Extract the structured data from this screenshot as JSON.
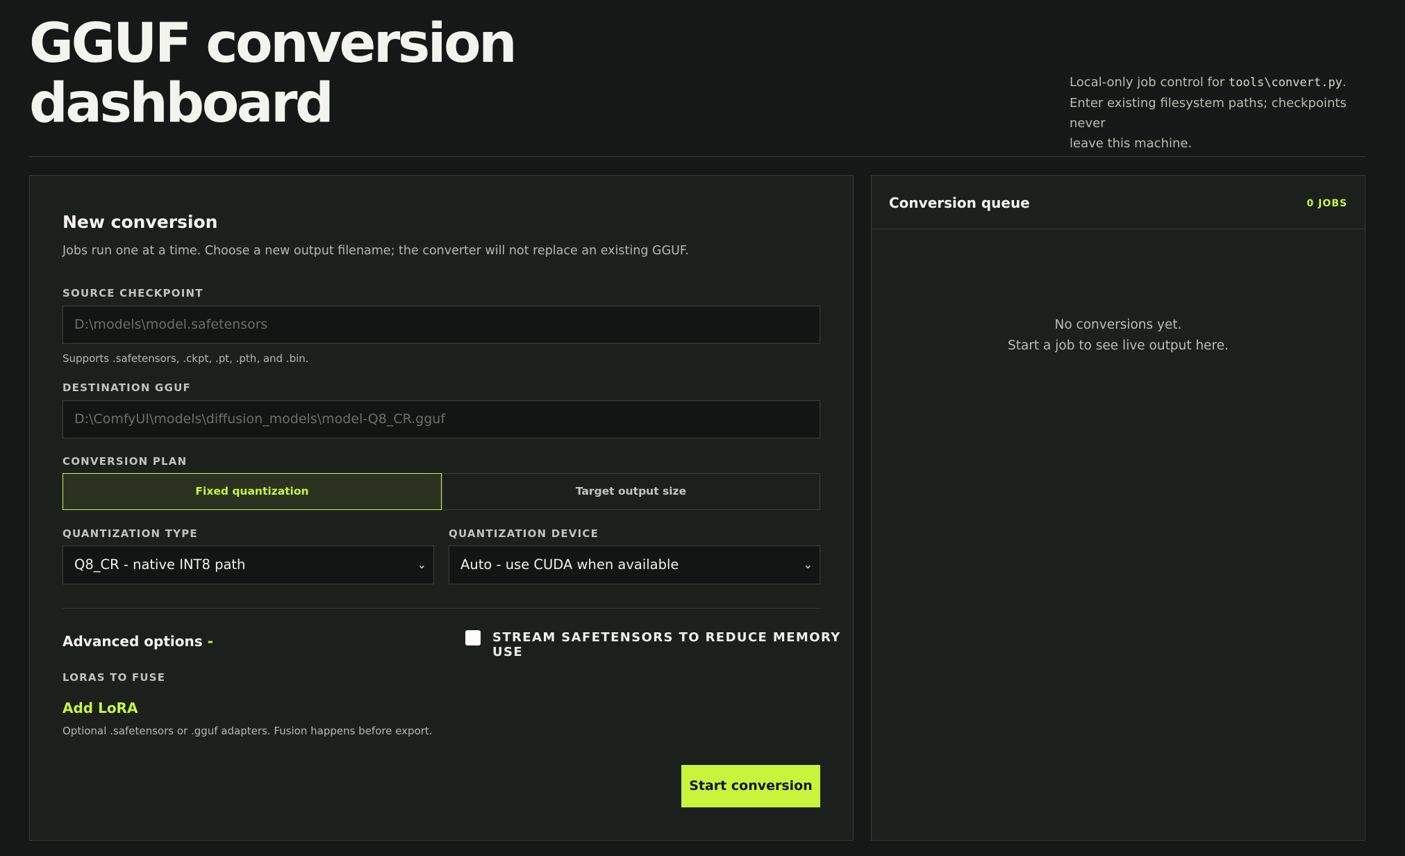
{
  "header": {
    "title_line1": "GGUF conversion",
    "title_line2": "dashboard",
    "desc_prefix": "Local-only job control for ",
    "desc_code": "tools\\convert.py",
    "desc_suffix": ".",
    "desc_line2": "Enter existing filesystem paths; checkpoints never",
    "desc_line3": "leave this machine."
  },
  "form": {
    "title": "New conversion",
    "description": "Jobs run one at a time. Choose a new output filename; the converter will not replace an existing GGUF.",
    "source": {
      "label": "SOURCE CHECKPOINT",
      "placeholder": "D:\\models\\model.safetensors",
      "hint": "Supports .safetensors, .ckpt, .pt, .pth, and .bin."
    },
    "destination": {
      "label": "DESTINATION GGUF",
      "placeholder": "D:\\ComfyUI\\models\\diffusion_models\\model-Q8_CR.gguf"
    },
    "plan": {
      "label": "CONVERSION PLAN",
      "options": [
        "Fixed quantization",
        "Target output size"
      ],
      "selected": "Fixed quantization"
    },
    "quant_type": {
      "label": "QUANTIZATION TYPE",
      "value": "Q8_CR - native INT8 path"
    },
    "quant_device": {
      "label": "QUANTIZATION DEVICE",
      "value": "Auto - use CUDA when available"
    },
    "advanced": {
      "title": "Advanced options",
      "toggle": "-",
      "stream_label": "STREAM SAFETENSORS TO REDUCE MEMORY USE",
      "stream_checked": false,
      "loras_label": "LORAS TO FUSE",
      "add_lora": "Add LoRA",
      "lora_hint": "Optional .safetensors or .gguf adapters. Fusion happens before export."
    },
    "start_button": "Start conversion"
  },
  "queue": {
    "title": "Conversion queue",
    "count": "0 JOBS",
    "empty_line1": "No conversions yet.",
    "empty_line2": "Start a job to see live output here."
  },
  "colors": {
    "accent": "#c8f53c",
    "background": "#151816",
    "panel": "#1c201d"
  }
}
